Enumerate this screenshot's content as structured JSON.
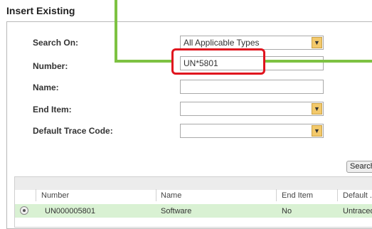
{
  "dialog": {
    "title": "Insert Existing"
  },
  "form": {
    "search_on": {
      "label": "Search On:",
      "value": "All Applicable Types"
    },
    "number": {
      "label": "Number:",
      "value": "UN*5801"
    },
    "name": {
      "label": "Name:",
      "value": ""
    },
    "end_item": {
      "label": "End Item:",
      "value": ""
    },
    "default_trace_code": {
      "label": "Default Trace Code:",
      "value": ""
    },
    "search_button": "Search"
  },
  "results": {
    "columns": [
      "Number",
      "Name",
      "End Item",
      "Default ..."
    ],
    "rows": [
      {
        "number": "UN000005801",
        "name": "Software",
        "end_item": "No",
        "default_trace_code": "Untraced"
      }
    ]
  },
  "colors": {
    "annotation_line": "#7dc242",
    "highlight_box": "#e0141e",
    "dropdown_button": "#f3c96b",
    "selected_row": "#d9f1d3"
  }
}
